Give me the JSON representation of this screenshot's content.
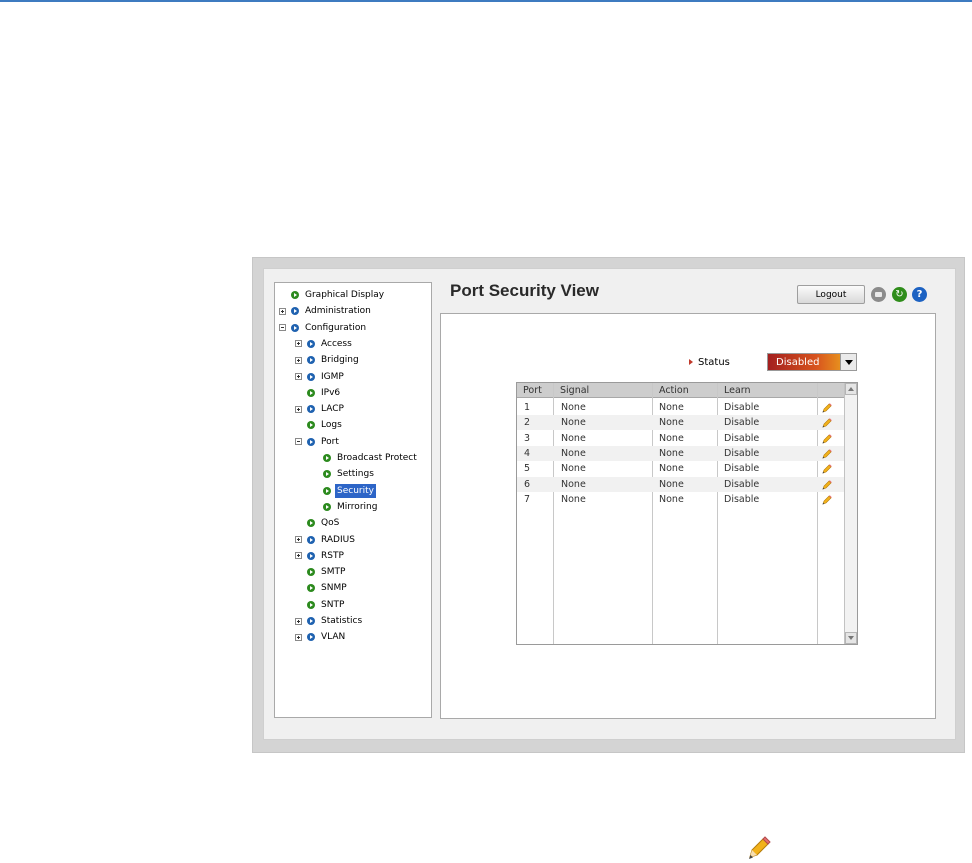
{
  "header": {
    "title": "Port Security View",
    "logout_label": "Logout",
    "print_icon": "print-icon",
    "refresh_icon": "refresh-icon",
    "help_icon": "help-icon"
  },
  "tree": {
    "items": [
      {
        "label": "Graphical Display",
        "color": "green",
        "expander": "none",
        "selected": false
      },
      {
        "label": "Administration",
        "color": "blue",
        "expander": "plus",
        "selected": false
      },
      {
        "label": "Configuration",
        "color": "blue",
        "expander": "minus",
        "selected": false
      },
      {
        "label": "Access",
        "color": "blue",
        "expander": "plus",
        "selected": false
      },
      {
        "label": "Bridging",
        "color": "blue",
        "expander": "plus",
        "selected": false
      },
      {
        "label": "IGMP",
        "color": "blue",
        "expander": "plus",
        "selected": false
      },
      {
        "label": "IPv6",
        "color": "green",
        "expander": "none",
        "selected": false
      },
      {
        "label": "LACP",
        "color": "blue",
        "expander": "plus",
        "selected": false
      },
      {
        "label": "Logs",
        "color": "green",
        "expander": "none",
        "selected": false
      },
      {
        "label": "Port",
        "color": "blue",
        "expander": "minus",
        "selected": false
      },
      {
        "label": "Broadcast Protect",
        "color": "green",
        "expander": "none",
        "selected": false
      },
      {
        "label": "Settings",
        "color": "green",
        "expander": "none",
        "selected": false
      },
      {
        "label": "Security",
        "color": "green",
        "expander": "none",
        "selected": true
      },
      {
        "label": "Mirroring",
        "color": "green",
        "expander": "none",
        "selected": false
      },
      {
        "label": "QoS",
        "color": "green",
        "expander": "none",
        "selected": false
      },
      {
        "label": "RADIUS",
        "color": "blue",
        "expander": "plus",
        "selected": false
      },
      {
        "label": "RSTP",
        "color": "blue",
        "expander": "plus",
        "selected": false
      },
      {
        "label": "SMTP",
        "color": "green",
        "expander": "none",
        "selected": false
      },
      {
        "label": "SNMP",
        "color": "green",
        "expander": "none",
        "selected": false
      },
      {
        "label": "SNTP",
        "color": "green",
        "expander": "none",
        "selected": false
      },
      {
        "label": "Statistics",
        "color": "blue",
        "expander": "plus",
        "selected": false
      },
      {
        "label": "VLAN",
        "color": "blue",
        "expander": "plus",
        "selected": false
      }
    ]
  },
  "status": {
    "label": "Status",
    "value": "Disabled"
  },
  "table": {
    "columns": [
      "Port",
      "Signal",
      "Action",
      "Learn"
    ],
    "rows": [
      [
        "1",
        "None",
        "None",
        "Disable"
      ],
      [
        "2",
        "None",
        "None",
        "Disable"
      ],
      [
        "3",
        "None",
        "None",
        "Disable"
      ],
      [
        "4",
        "None",
        "None",
        "Disable"
      ],
      [
        "5",
        "None",
        "None",
        "Disable"
      ],
      [
        "6",
        "None",
        "None",
        "Disable"
      ],
      [
        "7",
        "None",
        "None",
        "Disable"
      ]
    ],
    "row_action_icon": "edit-pencil-icon"
  },
  "footer": {
    "icon": "edit-pencil-icon"
  },
  "colors": {
    "accent_blue": "#1f62b0",
    "node_green": "#2c8a1e",
    "selection": "#2d65c7",
    "status_gradient_start": "#a31f1f",
    "status_gradient_end": "#f0b61f"
  }
}
